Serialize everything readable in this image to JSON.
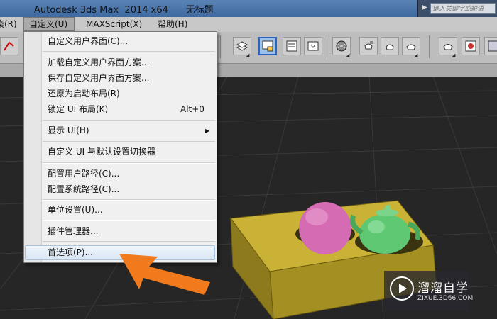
{
  "window": {
    "title": "Autodesk 3ds Max  2014 x64      无标题",
    "search_placeholder": "键入关键字或短语"
  },
  "menubar": {
    "partial_left": "染(R)",
    "items": [
      "自定义(U)",
      "MAXScript(X)",
      "帮助(H)"
    ],
    "active": "自定义(U)"
  },
  "dropdown": {
    "items": [
      {
        "label": "自定义用户界面(C)..."
      },
      {
        "label": "加载自定义用户界面方案..."
      },
      {
        "label": "保存自定义用户界面方案..."
      },
      {
        "label": "还原为启动布局(R)"
      },
      {
        "label": "锁定 UI 布局(K)",
        "shortcut": "Alt+0"
      },
      {
        "label": "显示 UI(H)",
        "submenu": true
      },
      {
        "label": "自定义 UI 与默认设置切换器"
      },
      {
        "label": "配置用户路径(C)..."
      },
      {
        "label": "配置系统路径(C)..."
      },
      {
        "label": "单位设置(U)..."
      },
      {
        "label": "插件管理器..."
      },
      {
        "label": "首选项(P)...",
        "highlighted": true
      }
    ]
  },
  "colors": {
    "arrow": "#f07a1c",
    "sphere": "#d46bb3",
    "teapot": "#5fc873",
    "box": "#c9b236",
    "highlight_border": "#a8c2e0"
  },
  "watermark": {
    "title": "溜溜自学",
    "url": "ZIXUE.3D66.COM"
  }
}
